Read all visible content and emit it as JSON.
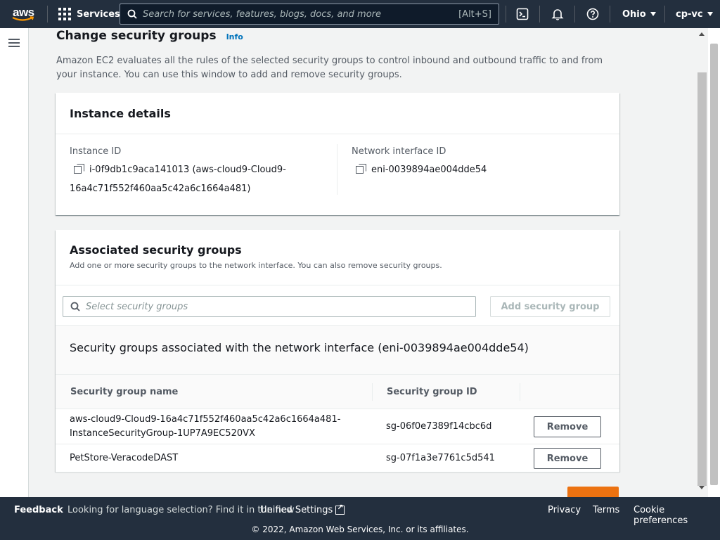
{
  "topnav": {
    "logo_text": "aws",
    "services_label": "Services",
    "search_placeholder": "Search for services, features, blogs, docs, and more",
    "search_shortcut": "[Alt+S]",
    "region": "Ohio",
    "account": "cp-vc",
    "icons": [
      "cloudshell-icon",
      "bell-icon",
      "help-icon"
    ]
  },
  "page": {
    "title": "Change security groups",
    "info_label": "Info",
    "description": "Amazon EC2 evaluates all the rules of the selected security groups to control inbound and outbound traffic to and from your instance. You can use this window to add and remove security groups."
  },
  "instance_details": {
    "title": "Instance details",
    "instance_id_label": "Instance ID",
    "instance_id_line1": "i-0f9db1c9aca141013 (aws-cloud9-Cloud9-",
    "instance_id_line2": "16a4c71f552f460aa5c42a6c1664a481)",
    "eni_label": "Network interface ID",
    "eni_value": "eni-0039894ae004dde54"
  },
  "associated": {
    "title": "Associated security groups",
    "subtitle": "Add one or more security groups to the network interface. You can also remove security groups.",
    "search_placeholder": "Select security groups",
    "add_button": "Add security group",
    "table_title": "Security groups associated with the network interface (eni-0039894ae004dde54)",
    "columns": [
      "Security group name",
      "Security group ID"
    ],
    "rows": [
      {
        "name_line1": "aws-cloud9-Cloud9-16a4c71f552f460aa5c42a6c1664a481-",
        "name_line2": "InstanceSecurityGroup-1UP7A9EC520VX",
        "id": "sg-06f0e7389f14cbc6d",
        "action": "Remove"
      },
      {
        "name_line1": "PetStore-VeracodeDAST",
        "name_line2": "",
        "id": "sg-07f1a3e7761c5d541",
        "action": "Remove"
      }
    ]
  },
  "footer": {
    "feedback": "Feedback",
    "language_text": "Looking for language selection? Find it in the new",
    "unified_settings": "Unified Settings",
    "privacy": "Privacy",
    "terms": "Terms",
    "cookies": "Cookie preferences",
    "copyright": "© 2022, Amazon Web Services, Inc. or its affiliates."
  },
  "colors": {
    "nav_bg": "#232f3e",
    "link": "#0073bb",
    "primary_orange": "#ec7211"
  }
}
